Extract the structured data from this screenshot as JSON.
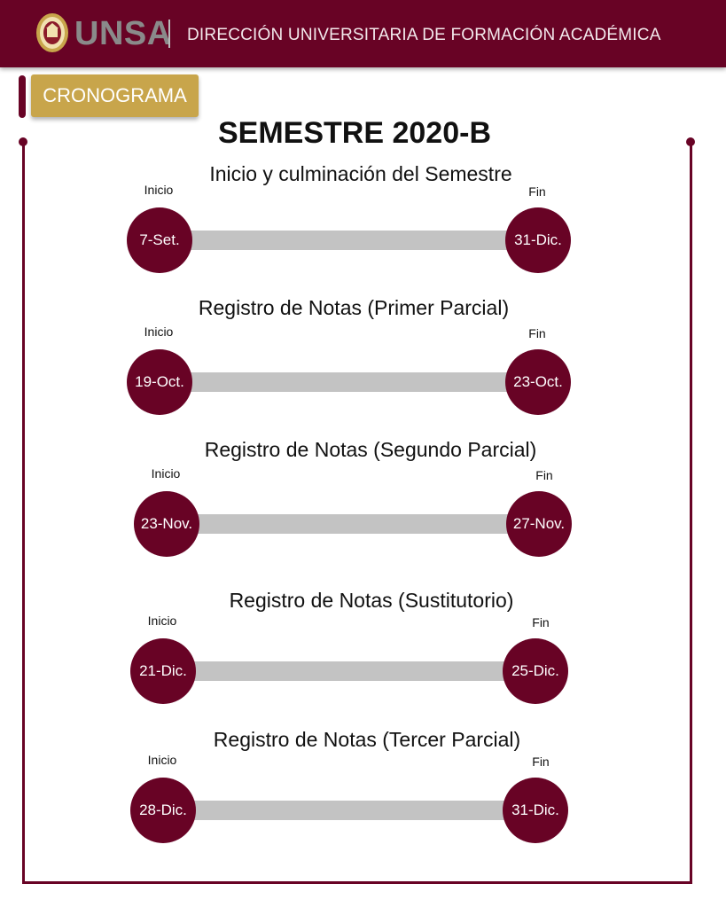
{
  "header": {
    "brand": "UNSA",
    "title": "DIRECCIÓN UNIVERSITARIA DE FORMACIÓN ACADÉMICA",
    "color": "#680325"
  },
  "badge": {
    "label": "CRONOGRAMA",
    "color": "#c8a54b"
  },
  "semester": "SEMESTRE 2020-B",
  "sections": [
    {
      "title": "Inicio y culminación del Semestre",
      "start_label": "Inicio",
      "end_label": "Fin",
      "start": "7-Set.",
      "end": "31-Dic."
    },
    {
      "title": "Registro de Notas (Primer Parcial)",
      "start_label": "Inicio",
      "end_label": "Fin",
      "start": "19-Oct.",
      "end": "23-Oct."
    },
    {
      "title": "Registro de Notas (Segundo Parcial)",
      "start_label": "Inicio",
      "end_label": "Fin",
      "start": "23-Nov.",
      "end": "27-Nov."
    },
    {
      "title": "Registro de Notas (Sustitutorio)",
      "start_label": "Inicio",
      "end_label": "Fin",
      "start": "21-Dic.",
      "end": "25-Dic."
    },
    {
      "title": "Registro de Notas (Tercer Parcial)",
      "start_label": "Inicio",
      "end_label": "Fin",
      "start": "28-Dic.",
      "end": "31-Dic."
    }
  ]
}
